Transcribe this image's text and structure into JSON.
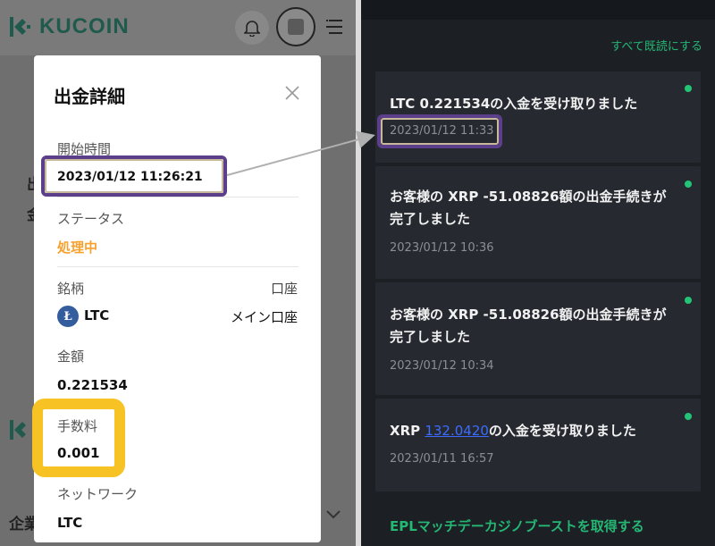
{
  "left": {
    "logo_text": "KUCOIN",
    "bg_line_1": "出",
    "bg_line_2": "金",
    "bg_line_3": "企業",
    "modal": {
      "title": "出金詳細",
      "start_time_label": "開始時間",
      "start_time_value": "2023/01/12 11:26:21",
      "status_label": "ステータス",
      "status_value": "処理中",
      "symbol_label": "銘柄",
      "account_label": "口座",
      "symbol_value": "LTC",
      "account_value": "メイン口座",
      "amount_label": "金額",
      "amount_value": "0.221534",
      "fee_label": "手数料",
      "fee_value": "0.001",
      "network_label": "ネットワーク",
      "network_value": "LTC"
    }
  },
  "right": {
    "mark_all_read": "すべて既読にする",
    "notifications": [
      {
        "title": "LTC 0.221534の入金を受け取りました",
        "time": "2023/01/12 11:33"
      },
      {
        "title": "お客様の XRP -51.08826額の出金手続きが完了しました",
        "time": "2023/01/12 10:36"
      },
      {
        "title": "お客様の XRP -51.08826額の出金手続きが完了しました",
        "time": "2023/01/12 10:34"
      },
      {
        "title_prefix": "XRP ",
        "title_link": "132.0420",
        "title_suffix": "の入金を受け取りました",
        "time": "2023/01/11 16:57"
      }
    ],
    "bottom_link": "EPLマッチデーカジノブーストを取得する"
  },
  "colors": {
    "kucoin_green": "#1f5a4c",
    "status_orange": "#f7a12e",
    "unread_dot": "#23c476",
    "highlight_purple": "#5c3f8a",
    "highlight_yellow": "#f6c224"
  }
}
